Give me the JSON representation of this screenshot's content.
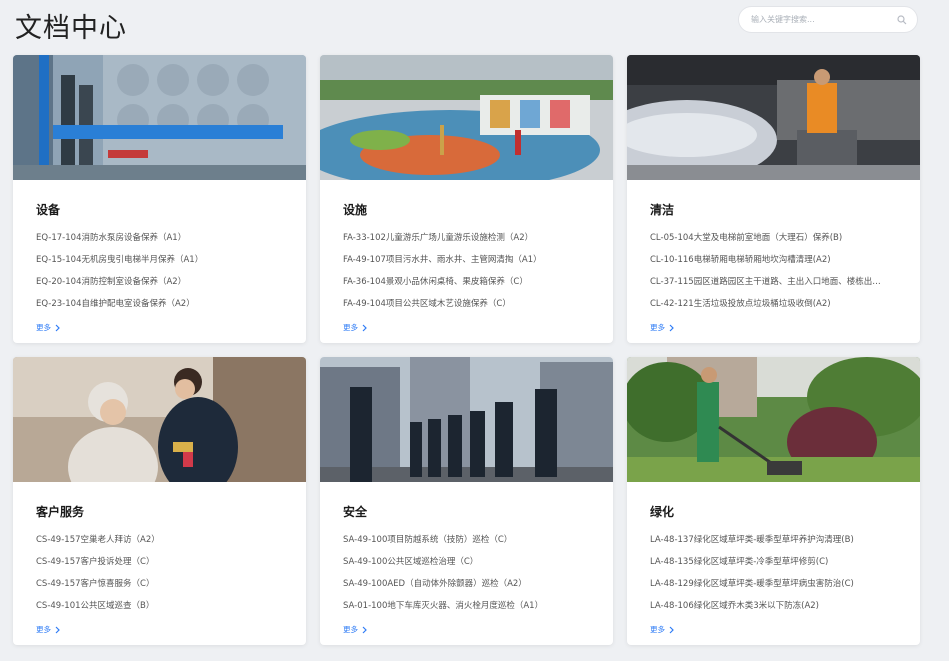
{
  "header": {
    "title": "文档中心",
    "search_placeholder": "输入关键字搜索..."
  },
  "cards": [
    {
      "title": "设备",
      "items": [
        "EQ-17-104消防水泵房设备保养（A1）",
        "EQ-15-104无机房曳引电梯半月保养（A1）",
        "EQ-20-104消防控制室设备保养（A2）",
        "EQ-23-104自维护配电室设备保养（A2）"
      ],
      "more": "更多"
    },
    {
      "title": "设施",
      "items": [
        "FA-33-102儿童游乐广场儿童游乐设施检测（A2）",
        "FA-49-107项目污水井、雨水井、主管网清掏（A1）",
        "FA-36-104景观小品休闲桌椅、果皮箱保养（C）",
        "FA-49-104项目公共区域木艺设施保养（C）"
      ],
      "more": "更多"
    },
    {
      "title": "清洁",
      "items": [
        "CL-05-104大堂及电梯前室地面（大理石）保养(B)",
        "CL-10-116电梯轿厢电梯轿厢地坎沟槽清理(A2)",
        "CL-37-115园区道路园区主干道路、主出入口地面、楼栋出…",
        "CL-42-121生活垃圾投放点垃圾桶垃圾收倒(A2)"
      ],
      "more": "更多"
    },
    {
      "title": "客户服务",
      "items": [
        "CS-49-157空巢老人拜访（A2）",
        "CS-49-157客户投诉处理（C）",
        "CS-49-157客户惊喜服务（C）",
        "CS-49-101公共区域巡查（B）"
      ],
      "more": "更多"
    },
    {
      "title": "安全",
      "items": [
        "SA-49-100项目防越系统（技防）巡检（C）",
        "SA-49-100公共区域巡检治理（C）",
        "SA-49-100AED（自动体外除颤器）巡检（A2）",
        "SA-01-100地下车库灭火器、消火栓月度巡检（A1）"
      ],
      "more": "更多"
    },
    {
      "title": "绿化",
      "items": [
        "LA-48-137绿化区域草坪类-暖季型草坪养护沟清理(B)",
        "LA-48-135绿化区域草坪类-冷季型草坪修剪(C)",
        "LA-48-129绿化区域草坪类-暖季型草坪病虫害防治(C)",
        "LA-48-106绿化区域乔木类3米以下防冻(A2)"
      ],
      "more": "更多"
    }
  ],
  "colors": {
    "accent": "#2f7cf6",
    "background": "#eef0f3"
  }
}
